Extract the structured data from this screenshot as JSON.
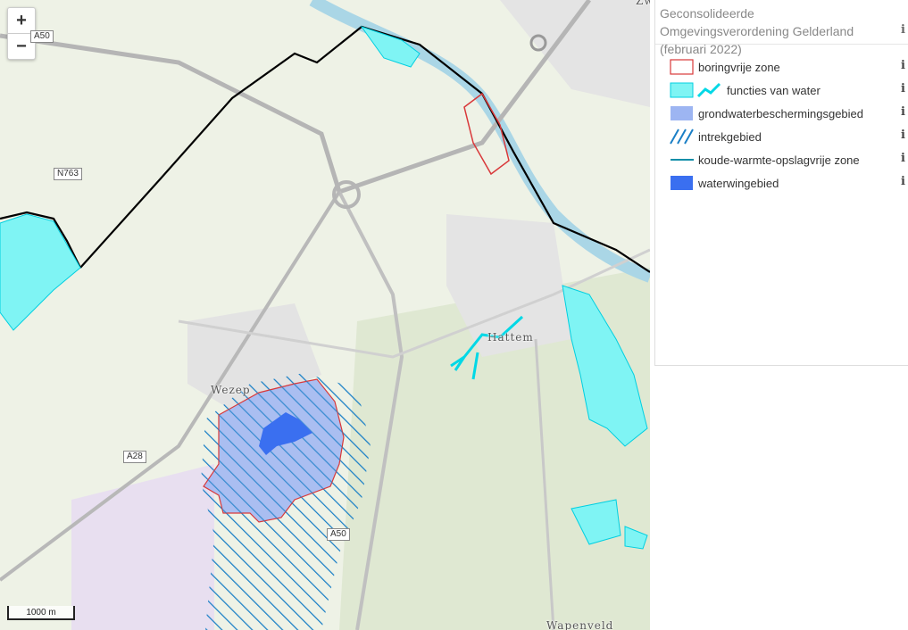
{
  "zoom": {
    "in_label": "+",
    "out_label": "−"
  },
  "map": {
    "road_labels": [
      "A50",
      "N763",
      "A28",
      "A50"
    ],
    "place_labels": [
      "Wezep",
      "Hattem",
      "Wapenveld",
      "Zw"
    ],
    "scale_label": "1000 m"
  },
  "legend": {
    "title": "Geconsolideerde Omgevingsverordening Gelderland (februari 2022)",
    "info_glyph": "i",
    "items": [
      {
        "label": "boringvrije zone",
        "symbol": "red-outline-box-icon"
      },
      {
        "label": "functies van water",
        "symbol": "cyan-area-line-icon"
      },
      {
        "label": "grondwaterbeschermingsgebied",
        "symbol": "light-blue-fill-icon"
      },
      {
        "label": "intrekgebied",
        "symbol": "blue-hatch-icon"
      },
      {
        "label": "koude-warmte-opslagvrije zone",
        "symbol": "teal-line-icon"
      },
      {
        "label": "waterwingebied",
        "symbol": "blue-fill-icon"
      }
    ]
  },
  "colors": {
    "boringvrije": "#d9383a",
    "functies_water": "#7ff4f4",
    "functies_water_line": "#00d8e6",
    "grondwater": "#9db5f2",
    "intrek": "#1a7fc6",
    "kwo": "#0f8ea8",
    "waterwin": "#3a6ff0"
  }
}
